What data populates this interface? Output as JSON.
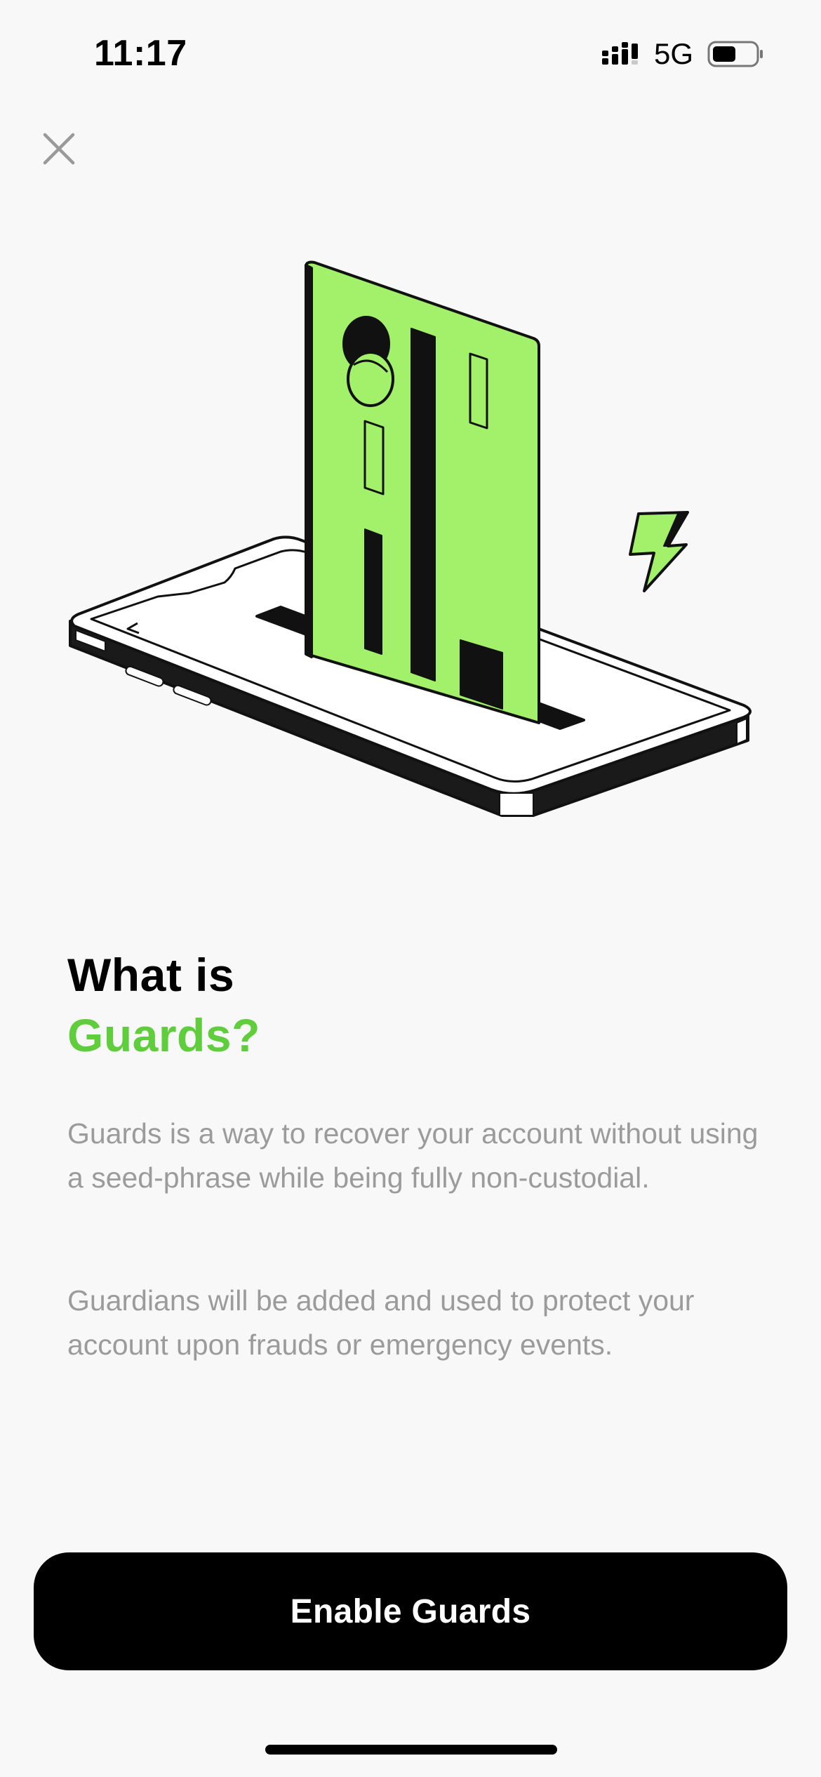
{
  "status_bar": {
    "time": "11:17",
    "network": "5G",
    "signal_icon": "signal-bars-icon",
    "battery_icon": "battery-icon",
    "battery_level": 0.55
  },
  "close_icon": "close-icon",
  "illustration": {
    "name": "phone-with-card-illustration",
    "accent_color": "#a3f06b",
    "lightning_icon": "lightning-bolt-icon",
    "back_chevron": "<"
  },
  "headline": {
    "line1": "What is",
    "line2": "Guards?"
  },
  "body": {
    "paragraph1": "Guards is a way to recover your account without using a seed-phrase while being fully non-custodial.",
    "paragraph2": "Guardians will be added and used to protect your account upon frauds or emergency events."
  },
  "cta": {
    "label": "Enable Guards"
  },
  "colors": {
    "background": "#f8f8f8",
    "accent_text": "#5fcd3c",
    "body_text": "#9b9b9b",
    "button_bg": "#000000",
    "button_text": "#ffffff"
  }
}
